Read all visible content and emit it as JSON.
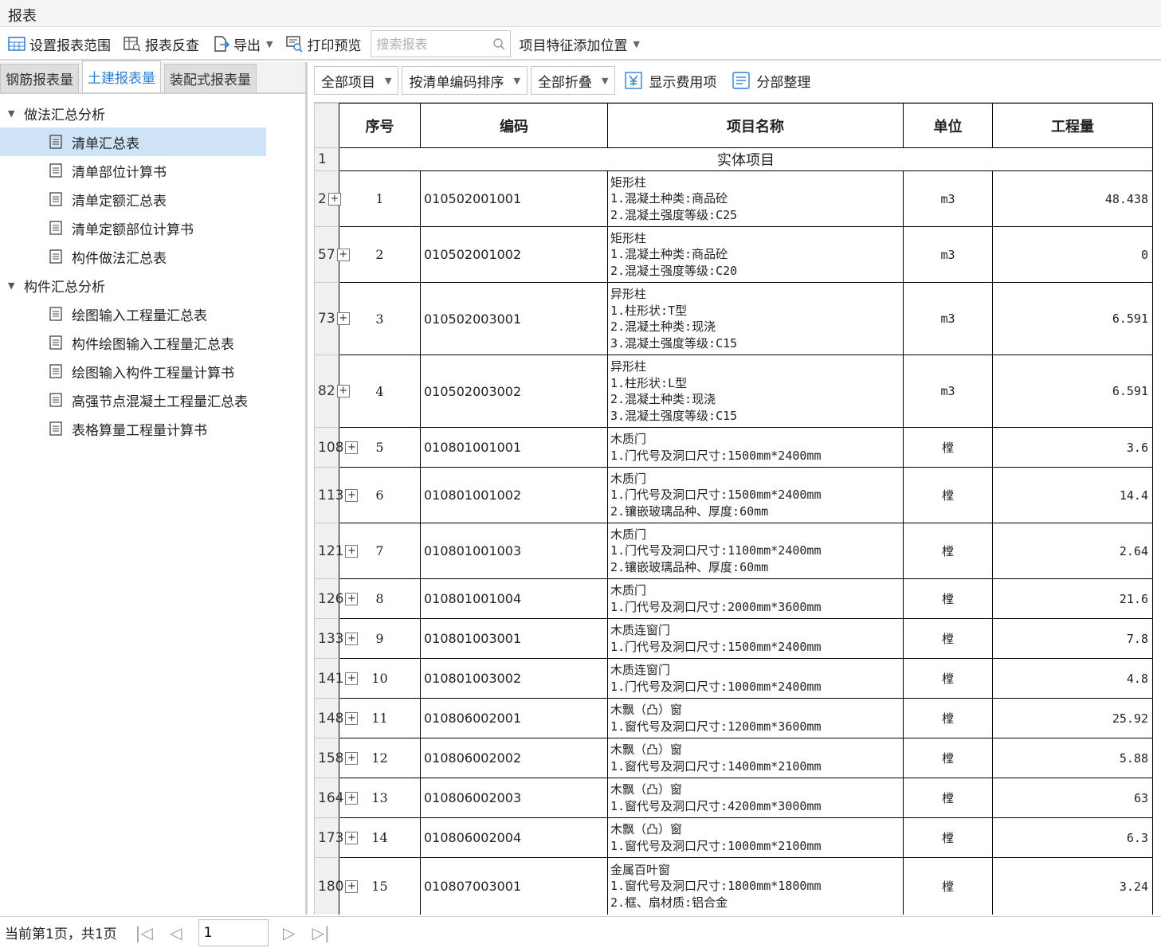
{
  "window": {
    "title": "报表"
  },
  "toolbar": {
    "set_range": "设置报表范围",
    "reverse_check": "报表反查",
    "export": "导出",
    "print_preview": "打印预览",
    "search_placeholder": "搜索报表",
    "feature_position": "项目特征添加位置"
  },
  "left_tabs": [
    "钢筋报表量",
    "土建报表量",
    "装配式报表量"
  ],
  "tree": {
    "group1": "做法汇总分析",
    "group1_items": [
      "清单汇总表",
      "清单部位计算书",
      "清单定额汇总表",
      "清单定额部位计算书",
      "构件做法汇总表"
    ],
    "group2": "构件汇总分析",
    "group2_items": [
      "绘图输入工程量汇总表",
      "构件绘图输入工程量汇总表",
      "绘图输入构件工程量计算书",
      "高强节点混凝土工程量汇总表",
      "表格算量工程量计算书"
    ]
  },
  "right_toolbar": {
    "all_items": "全部项目",
    "sort_by_code": "按清单编码排序",
    "collapse_all": "全部折叠",
    "show_fee_items": "显示费用项",
    "section_arrange": "分部整理"
  },
  "table": {
    "headers": {
      "seq": "序号",
      "code": "编码",
      "name": "项目名称",
      "unit": "单位",
      "qty": "工程量"
    },
    "section_row": {
      "row_no": "1",
      "label": "实体项目"
    },
    "rows": [
      {
        "row_no": "2",
        "seq": "1",
        "code": "010502001001",
        "name": "矩形柱\n1.混凝土种类:商品砼\n2.混凝土强度等级:C25",
        "unit": "m3",
        "qty": "48.438"
      },
      {
        "row_no": "57",
        "seq": "2",
        "code": "010502001002",
        "name": "矩形柱\n1.混凝土种类:商品砼\n2.混凝土强度等级:C20",
        "unit": "m3",
        "qty": "0"
      },
      {
        "row_no": "73",
        "seq": "3",
        "code": "010502003001",
        "name": "异形柱\n1.柱形状:T型\n2.混凝土种类:现浇\n3.混凝土强度等级:C15",
        "unit": "m3",
        "qty": "6.591"
      },
      {
        "row_no": "82",
        "seq": "4",
        "code": "010502003002",
        "name": "异形柱\n1.柱形状:L型\n2.混凝土种类:现浇\n3.混凝土强度等级:C15",
        "unit": "m3",
        "qty": "6.591"
      },
      {
        "row_no": "108",
        "seq": "5",
        "code": "010801001001",
        "name": "木质门\n1.门代号及洞口尺寸:1500mm*2400mm",
        "unit": "樘",
        "qty": "3.6"
      },
      {
        "row_no": "113",
        "seq": "6",
        "code": "010801001002",
        "name": "木质门\n1.门代号及洞口尺寸:1500mm*2400mm\n2.镶嵌玻璃品种、厚度:60mm",
        "unit": "樘",
        "qty": "14.4"
      },
      {
        "row_no": "121",
        "seq": "7",
        "code": "010801001003",
        "name": "木质门\n1.门代号及洞口尺寸:1100mm*2400mm\n2.镶嵌玻璃品种、厚度:60mm",
        "unit": "樘",
        "qty": "2.64"
      },
      {
        "row_no": "126",
        "seq": "8",
        "code": "010801001004",
        "name": "木质门\n1.门代号及洞口尺寸:2000mm*3600mm",
        "unit": "樘",
        "qty": "21.6"
      },
      {
        "row_no": "133",
        "seq": "9",
        "code": "010801003001",
        "name": "木质连窗门\n1.门代号及洞口尺寸:1500mm*2400mm",
        "unit": "樘",
        "qty": "7.8"
      },
      {
        "row_no": "141",
        "seq": "10",
        "code": "010801003002",
        "name": "木质连窗门\n1.门代号及洞口尺寸:1000mm*2400mm",
        "unit": "樘",
        "qty": "4.8"
      },
      {
        "row_no": "148",
        "seq": "11",
        "code": "010806002001",
        "name": "木飘（凸）窗\n1.窗代号及洞口尺寸:1200mm*3600mm",
        "unit": "樘",
        "qty": "25.92"
      },
      {
        "row_no": "158",
        "seq": "12",
        "code": "010806002002",
        "name": "木飘（凸）窗\n1.窗代号及洞口尺寸:1400mm*2100mm",
        "unit": "樘",
        "qty": "5.88"
      },
      {
        "row_no": "164",
        "seq": "13",
        "code": "010806002003",
        "name": "木飘（凸）窗\n1.窗代号及洞口尺寸:4200mm*3000mm",
        "unit": "樘",
        "qty": "63"
      },
      {
        "row_no": "173",
        "seq": "14",
        "code": "010806002004",
        "name": "木飘（凸）窗\n1.窗代号及洞口尺寸:1000mm*2100mm",
        "unit": "樘",
        "qty": "6.3"
      },
      {
        "row_no": "180",
        "seq": "15",
        "code": "010807003001",
        "name": "金属百叶窗\n1.窗代号及洞口尺寸:1800mm*1800mm\n2.框、扇材质:铝合金",
        "unit": "樘",
        "qty": "3.24"
      }
    ]
  },
  "footer": {
    "page_info": "当前第1页，共1页",
    "page_value": "1"
  },
  "colors": {
    "accent": "#2b7fd6",
    "selected_bg": "#cfe3f7"
  }
}
